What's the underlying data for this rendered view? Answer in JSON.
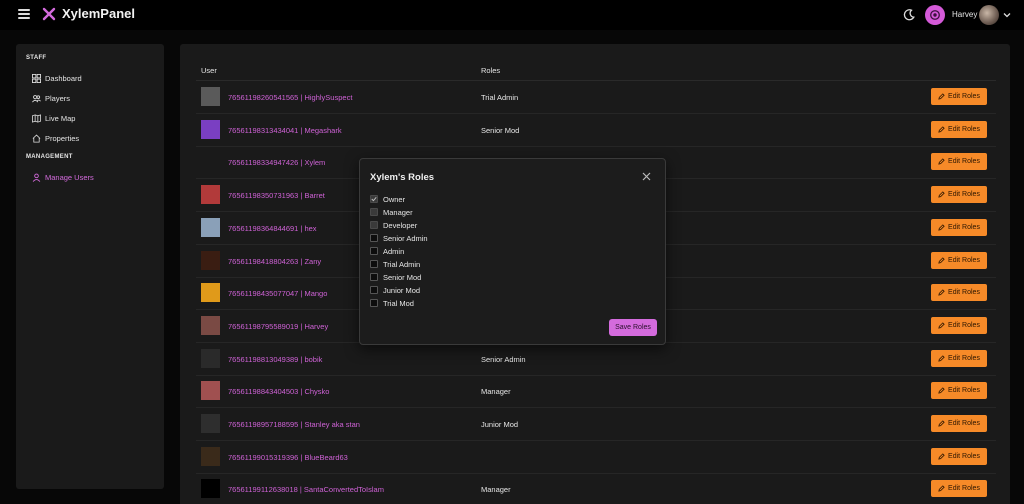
{
  "app": {
    "title": "XylemPanel"
  },
  "header": {
    "username": "Harvey"
  },
  "sidebar": {
    "staff_title": "STAFF",
    "management_title": "MANAGEMENT",
    "items": [
      {
        "label": "Dashboard",
        "icon": "dashboard-icon"
      },
      {
        "label": "Players",
        "icon": "players-icon"
      },
      {
        "label": "Live Map",
        "icon": "map-icon"
      },
      {
        "label": "Properties",
        "icon": "home-icon"
      },
      {
        "label": "Manage Users",
        "icon": "user-icon",
        "active": true
      }
    ]
  },
  "table": {
    "headers": {
      "user": "User",
      "roles": "Roles"
    },
    "edit_label": "Edit Roles",
    "rows": [
      {
        "user": "76561198260541565 | HighlySuspect",
        "role": "Trial Admin",
        "avatar_color": "#5a5a5a"
      },
      {
        "user": "76561198313434041 | Megashark",
        "role": "Senior Mod",
        "avatar_color": "#7a3fc2"
      },
      {
        "user": "76561198334947426 | Xylem",
        "role": "",
        "avatar_color": "#1a1a1a"
      },
      {
        "user": "76561198350731963 | Barret",
        "role": "",
        "avatar_color": "#b23a3a"
      },
      {
        "user": "76561198364844691 | hex",
        "role": "",
        "avatar_color": "#8aa0b8"
      },
      {
        "user": "76561198418804263 | Zany",
        "role": "",
        "avatar_color": "#3a1d12"
      },
      {
        "user": "76561198435077047 | Mango",
        "role": "",
        "avatar_color": "#e09a1a"
      },
      {
        "user": "76561198795589019 | Harvey",
        "role": "",
        "avatar_color": "#7a4a44"
      },
      {
        "user": "76561198813049389 | bobik",
        "role": "Senior Admin",
        "avatar_color": "#2a2a2a"
      },
      {
        "user": "76561198843404503 | Chysko",
        "role": "Manager",
        "avatar_color": "#a05050"
      },
      {
        "user": "76561198957188595 | Stanley aka stan",
        "role": "Junior Mod",
        "avatar_color": "#2e2e2e"
      },
      {
        "user": "76561199015319396 | BlueBeard63",
        "role": "",
        "avatar_color": "#3a2a1a"
      },
      {
        "user": "76561199112638018 | SantaConvertedToIslam",
        "role": "Manager",
        "avatar_color": "#000000"
      }
    ]
  },
  "modal": {
    "title": "Xylem's Roles",
    "save_label": "Save Roles",
    "roles": [
      {
        "label": "Owner",
        "checked": true,
        "disabled": true
      },
      {
        "label": "Manager",
        "checked": false,
        "disabled": true
      },
      {
        "label": "Developer",
        "checked": false,
        "disabled": true
      },
      {
        "label": "Senior Admin",
        "checked": false,
        "disabled": false
      },
      {
        "label": "Admin",
        "checked": false,
        "disabled": false
      },
      {
        "label": "Trial Admin",
        "checked": false,
        "disabled": false
      },
      {
        "label": "Senior Mod",
        "checked": false,
        "disabled": false
      },
      {
        "label": "Junior Mod",
        "checked": false,
        "disabled": false
      },
      {
        "label": "Trial Mod",
        "checked": false,
        "disabled": false
      }
    ]
  },
  "colors": {
    "accent": "#d46bdd",
    "edit_button": "#f68a28",
    "panel": "#1a1a1a",
    "background": "#070707"
  }
}
